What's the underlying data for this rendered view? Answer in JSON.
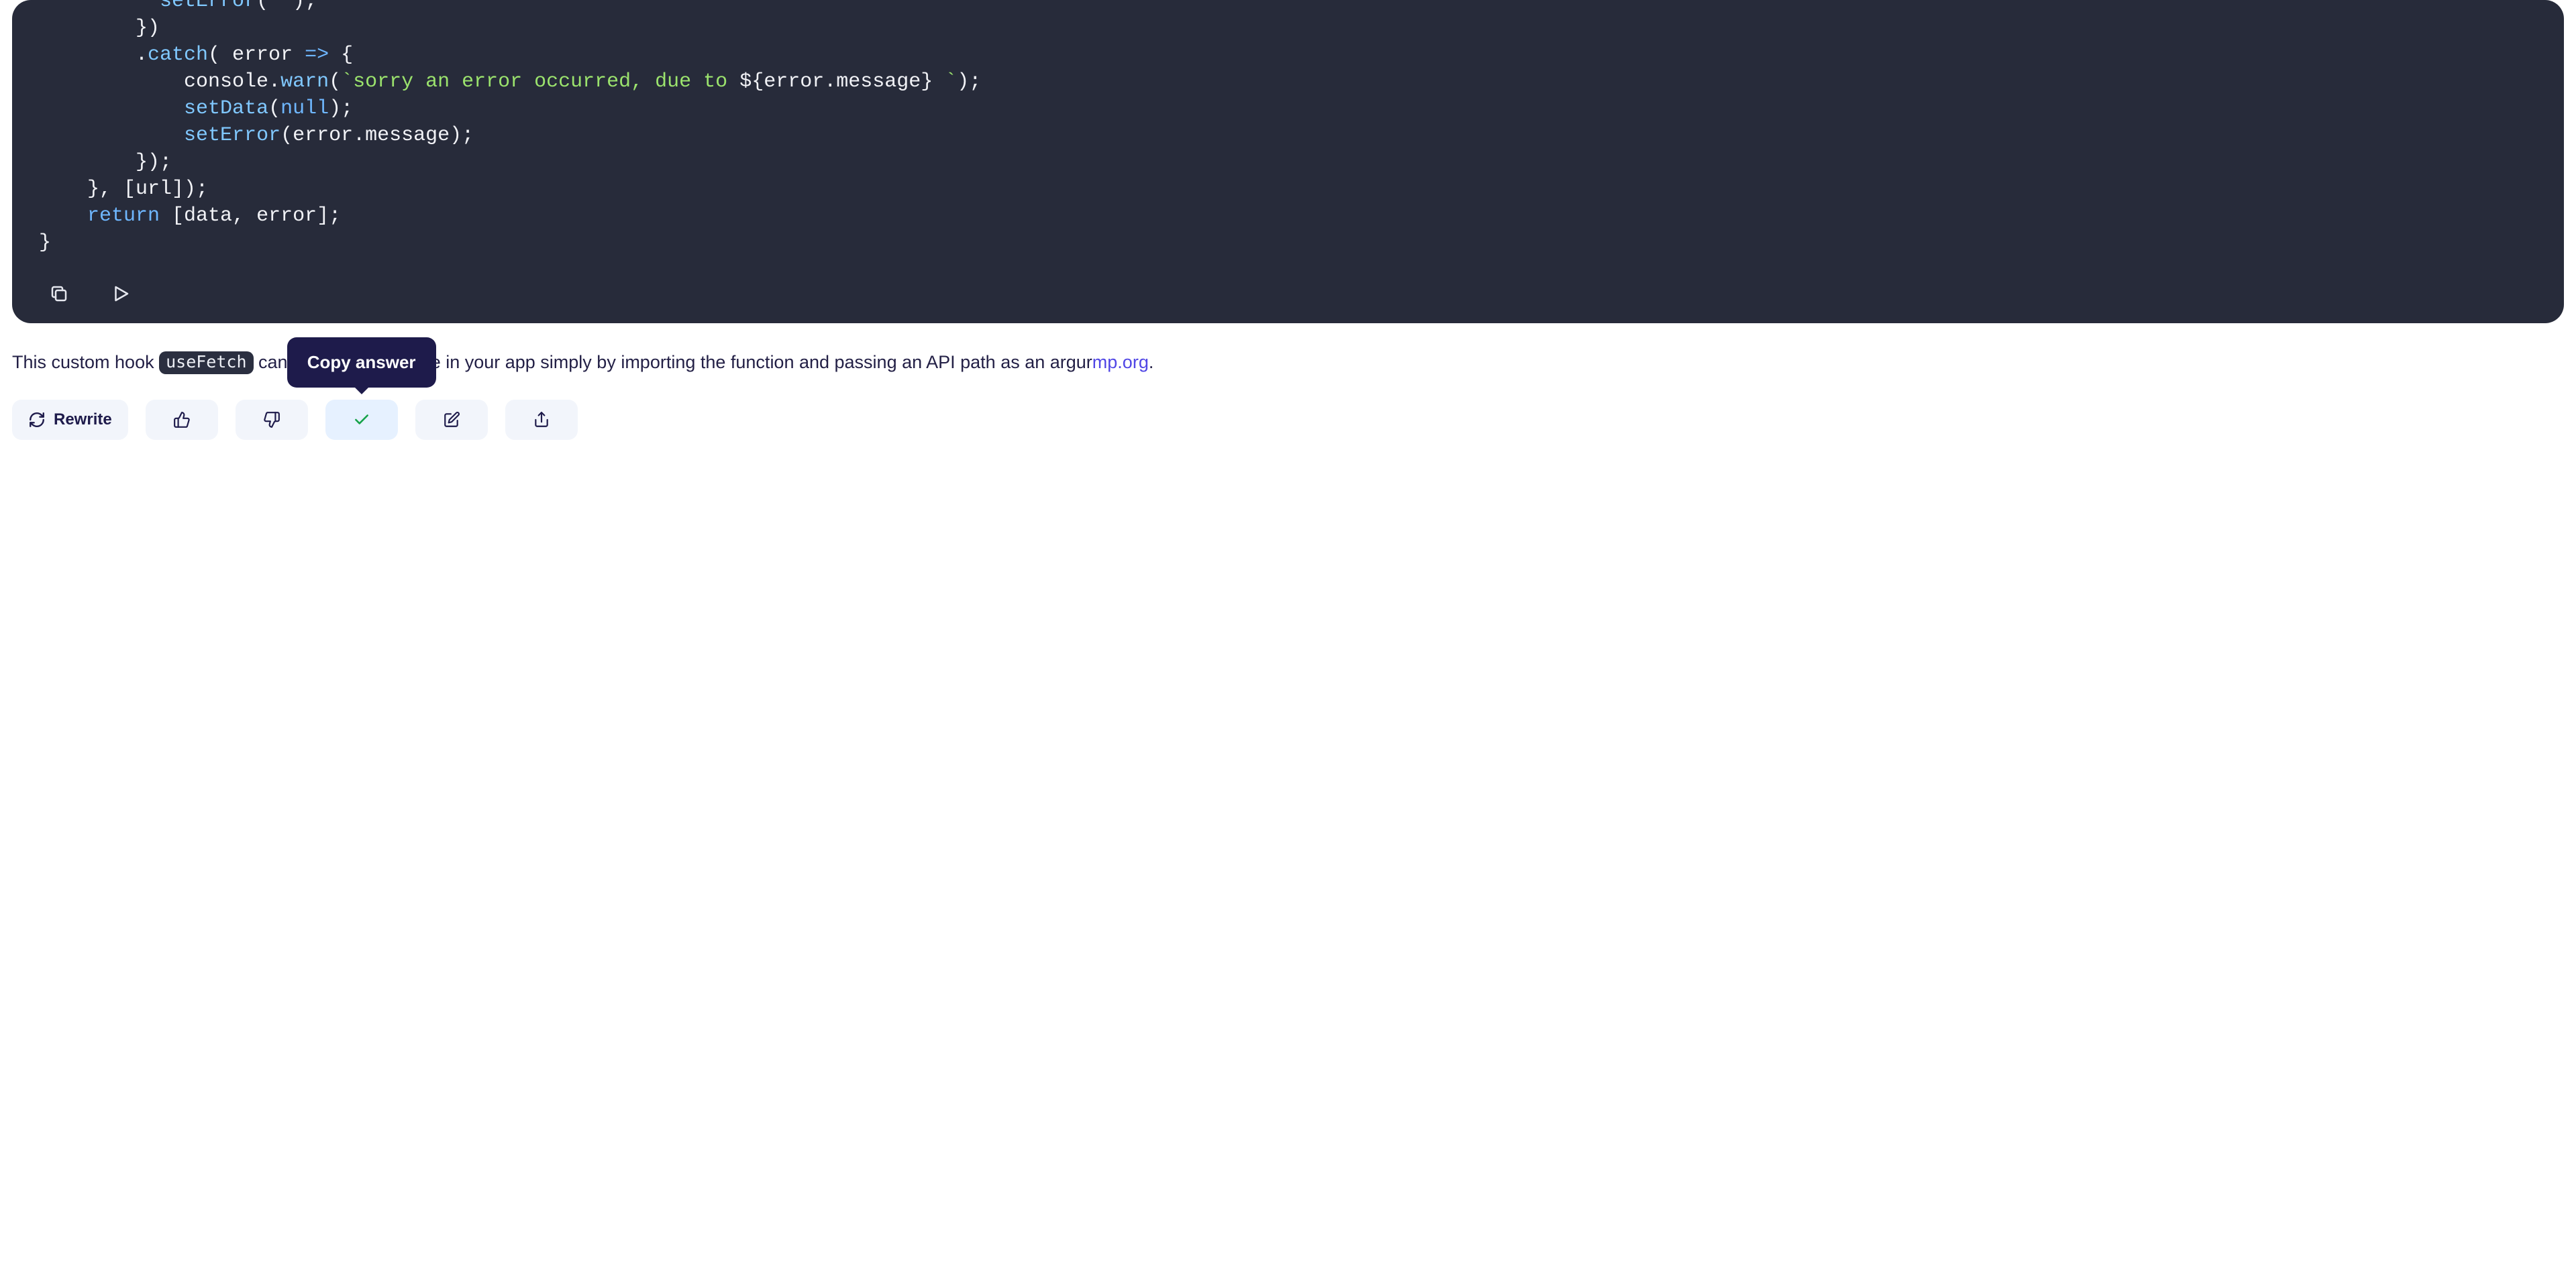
{
  "code": {
    "line1_fn": "setError",
    "line1_rest": "(",
    "line1_str": "\"\"",
    "line1_end": ");",
    "line2": "        })",
    "line3_pre": "        .",
    "line3_fn": "catch",
    "line3_mid": "( error ",
    "line3_arrow": "=>",
    "line3_end": " {",
    "line4_pre": "            console.",
    "line4_fn": "warn",
    "line4_open": "(",
    "line4_str_a": "`sorry an error occurred, due to ",
    "line4_interp": "${error.message}",
    "line4_str_b": " `",
    "line4_end": ");",
    "line5_pre": "            ",
    "line5_fn": "setData",
    "line5_open": "(",
    "line5_null": "null",
    "line5_end": ");",
    "line6_pre": "            ",
    "line6_fn": "setError",
    "line6_rest": "(error.message);",
    "line7": "        });",
    "line8": "    }, [url]);",
    "line9_pre": "    ",
    "line9_kw": "return",
    "line9_rest": " [data, error];",
    "line10": "}"
  },
  "answer": {
    "part1": "This custom hook ",
    "chip": "useFetch",
    "part2": " can be used anywhere in your app simply by importing the function and passing an API path as an argur",
    "link_tail": "mp.org",
    "period": "."
  },
  "toolbar": {
    "rewrite": "Rewrite",
    "tooltip": "Copy answer"
  }
}
